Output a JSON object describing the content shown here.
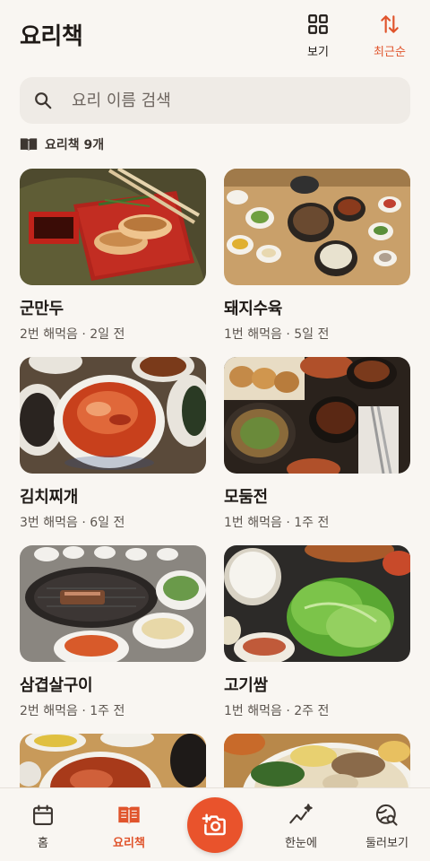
{
  "header": {
    "title": "요리책",
    "view_label": "보기",
    "sort_label": "최근순"
  },
  "search": {
    "placeholder": "요리 이름 검색"
  },
  "collection": {
    "count_label": "요리책 9개"
  },
  "recipes": [
    {
      "title": "군만두",
      "meta": "2번 해먹음 · 2일 전"
    },
    {
      "title": "돼지수육",
      "meta": "1번 해먹음 · 5일 전"
    },
    {
      "title": "김치찌개",
      "meta": "3번 해먹음 · 6일 전"
    },
    {
      "title": "모둠전",
      "meta": "1번 해먹음 · 1주 전"
    },
    {
      "title": "삼겹살구이",
      "meta": "2번 해먹음 · 1주 전"
    },
    {
      "title": "고기쌈",
      "meta": "1번 해먹음 · 2주 전"
    },
    {
      "title": "",
      "meta": ""
    },
    {
      "title": "",
      "meta": ""
    }
  ],
  "nav": {
    "home": "홈",
    "cookbook": "요리책",
    "glance": "한눈에",
    "explore": "둘러보기"
  },
  "colors": {
    "accent": "#e0542c",
    "background": "#f9f6f2",
    "search_bg": "#efebe6"
  },
  "icons": {
    "view": "grid-icon",
    "sort": "sort-arrows-icon",
    "search": "search-icon",
    "count": "book-open-icon",
    "home": "calendar-icon",
    "cookbook": "book-icon",
    "camera": "add-camera-icon",
    "glance": "sparkle-chart-icon",
    "explore": "globe-search-icon"
  }
}
